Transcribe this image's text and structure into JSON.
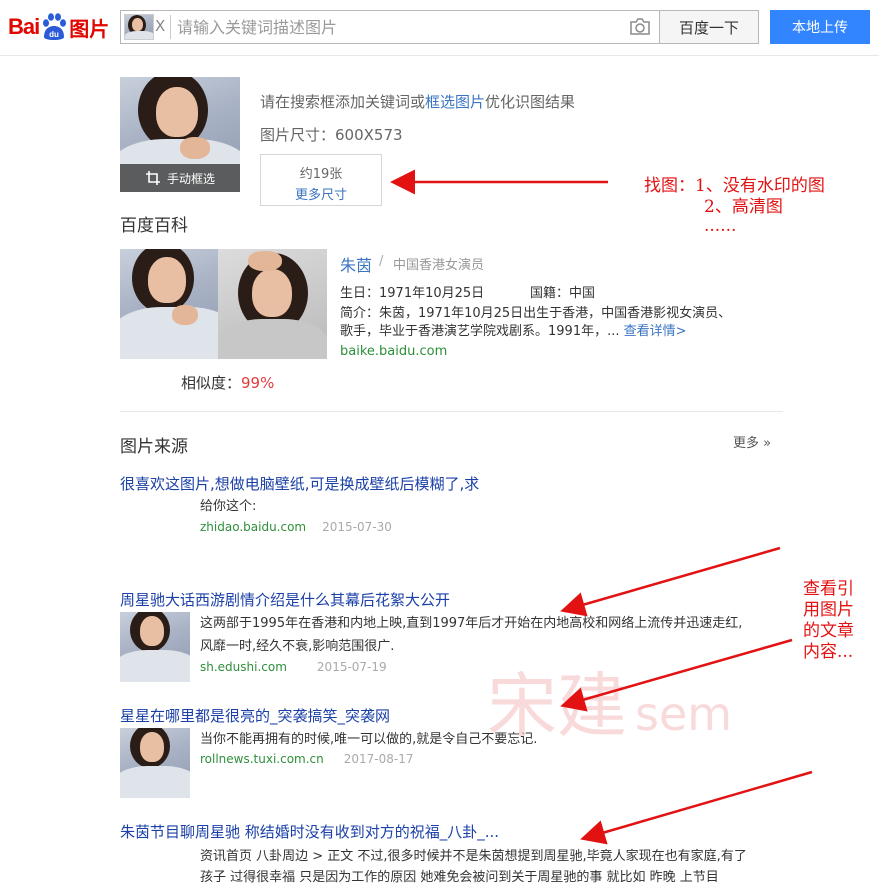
{
  "header": {
    "logo_bai": "Bai",
    "logo_du": "du",
    "logo_tupian": "图片",
    "thumb_close": "X",
    "search_placeholder": "请输入关键词描述图片",
    "search_button": "百度一下",
    "upload_button": "本地上传"
  },
  "result": {
    "crop_label": "手动框选",
    "hint_prefix": "请在搜索框添加关键词或",
    "hint_link": "框选图片",
    "hint_suffix": "优化识图结果",
    "size_text": "图片尺寸：600X573",
    "size_count": "约19张",
    "size_more": "更多尺寸"
  },
  "baike": {
    "section_title": "百度百科",
    "name": "朱茵",
    "separator": "/",
    "role": "中国香港女演员",
    "birth": "生日：1971年10月25日",
    "nationality": "国籍：中国",
    "intro_line1": "简介：朱茵，1971年10月25日出生于香港，中国香港影视女演员、",
    "intro_line2": "歌手，毕业于香港演艺学院戏剧系。1991年，...",
    "more_details": "查看详情>",
    "url": "baike.baidu.com",
    "similarity_label": "相似度：",
    "similarity_value": "99%"
  },
  "sources": {
    "section_title": "图片来源",
    "more": "更多 »",
    "items": [
      {
        "title": "很喜欢这图片,想做电脑壁纸,可是换成壁纸后模糊了,求",
        "text": "给你这个:",
        "site": "zhidao.baidu.com",
        "date": "2015-07-30"
      },
      {
        "title": "周星驰大话西游剧情介绍是什么其幕后花絮大公开",
        "text_line1": "这两部于1995年在香港和内地上映,直到1997年后才开始在内地高校和网络上流传并迅速走红,",
        "text_line2": "风靡一时,经久不衰,影响范围很广.",
        "site": "sh.edushi.com",
        "date": "2015-07-19"
      },
      {
        "title": "星星在哪里都是很亮的_突袭搞笑_突袭网",
        "text": "当你不能再拥有的时候,唯一可以做的,就是令自己不要忘记.",
        "site": "rollnews.tuxi.com.cn",
        "date": "2017-08-17"
      },
      {
        "title": "朱茵节目聊周星驰 称结婚时没有收到对方的祝福_八卦_...",
        "text_line1": "资讯首页 八卦周边 > 正文 不过,很多时候并不是朱茵想提到周星驰,毕竟人家现在也有家庭,有了",
        "text_line2": "孩子 过得很幸福 只是因为工作的原因 她难免会被问到关于周星驰的事 就比如 昨晚 上节目"
      }
    ]
  },
  "annotations": {
    "find_image_line1": "找图：1、没有水印的图",
    "find_image_line2": "2、高清图",
    "find_image_line3": "......",
    "reference_line1": "查看引",
    "reference_line2": "用图片",
    "reference_line3": "的文章",
    "reference_line4": "内容...",
    "watermark_text": "宋建",
    "watermark_sem": "sem",
    "color": "#e31212"
  }
}
